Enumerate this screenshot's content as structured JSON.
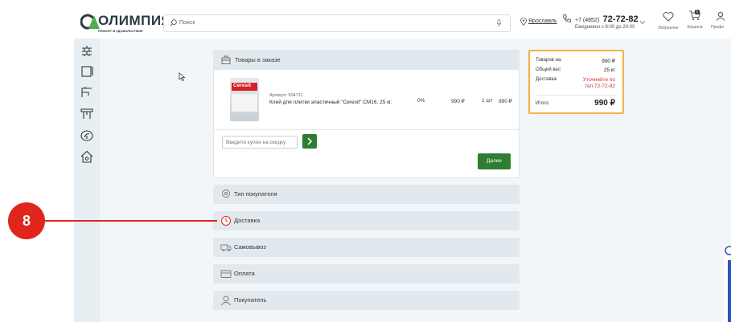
{
  "header": {
    "logo_text": "ОЛИМПИЯ",
    "logo_tagline": "РЕМОНТ В УДОВОЛЬСТВИЕ",
    "search_placeholder": "Поиск",
    "city": "Ярославль",
    "phone_prefix": "+7 (4852)",
    "phone_main": "72-72-82",
    "hours": "Ежедневно с 8:00 до 20:00",
    "favorites": "Избранное",
    "cart": "Корзина",
    "profile": "Профи",
    "cart_count": "1"
  },
  "order": {
    "title": "Товары в заказе",
    "item": {
      "sku_label": "Артикул: 504711",
      "name": "Клей для плитки эластичный \"Ceresit\" СМ16, 25 кг.",
      "discount": "0%",
      "price": "990 ₽",
      "qty": "1 шт",
      "total": "990 ₽",
      "brand_on_pack": "Ceresit"
    },
    "coupon_placeholder": "Введите купон на скидку",
    "next_button": "Далее"
  },
  "sections": [
    {
      "label": "Тип покупателя",
      "icon": "location-pin-icon"
    },
    {
      "label": "Доставка",
      "icon": "clock-icon"
    },
    {
      "label": "Самовывоз",
      "icon": "truck-icon"
    },
    {
      "label": "Оплата",
      "icon": "card-icon"
    },
    {
      "label": "Покупатель",
      "icon": "user-icon"
    }
  ],
  "summary": {
    "goods_label": "Товаров на:",
    "goods_value": "990 ₽",
    "weight_label": "Общий вес:",
    "weight_value": "25 кг",
    "delivery_label": "Доставка:",
    "delivery_value": "Уточняйте по тел.72-72-82",
    "total_label": "Итого:",
    "total_value": "990 ₽"
  },
  "annotation": {
    "step": "8"
  },
  "colors": {
    "accent_green": "#2e7d32",
    "annotation_red": "#e0261c",
    "summary_border": "#f1b24a",
    "delivery_red": "#d32f2f"
  }
}
